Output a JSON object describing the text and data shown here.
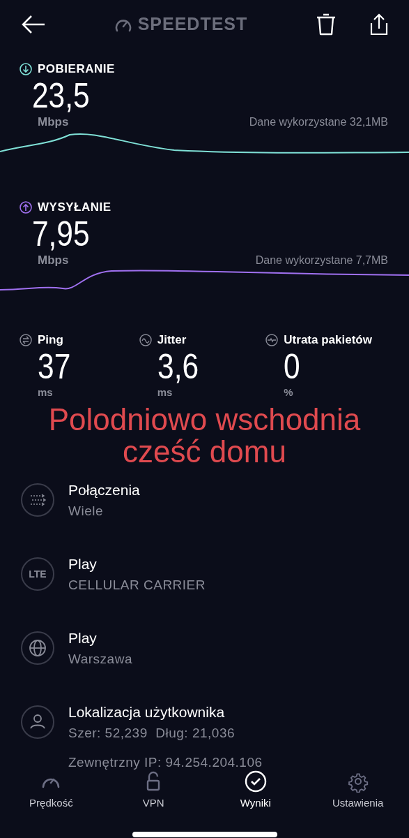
{
  "header": {
    "title": "SPEEDTEST"
  },
  "download": {
    "label": "POBIERANIE",
    "value": "23,5",
    "unit": "Mbps",
    "data_used": "Dane wykorzystane 32,1MB"
  },
  "upload": {
    "label": "WYSYŁANIE",
    "value": "7,95",
    "unit": "Mbps",
    "data_used": "Dane wykorzystane 7,7MB"
  },
  "metrics": [
    {
      "kind": "ping",
      "label": "Ping",
      "value": "37",
      "unit": "ms"
    },
    {
      "kind": "jitter",
      "label": "Jitter",
      "value": "3,6",
      "unit": "ms"
    },
    {
      "kind": "loss",
      "label": "Utrata pakietów",
      "value": "0",
      "unit": "%"
    }
  ],
  "annotation": [
    "Polodniowo wschodnia",
    "cześć domu"
  ],
  "info": [
    {
      "kind": "connections",
      "title": "Połączenia",
      "lines": [
        "Wiele"
      ]
    },
    {
      "kind": "lte",
      "badge": "LTE",
      "title": "Play",
      "lines": [
        "CELLULAR CARRIER"
      ]
    },
    {
      "kind": "globe",
      "title": "Play",
      "lines": [
        "Warszawa"
      ]
    },
    {
      "kind": "user",
      "title": "Lokalizacja użytkownika",
      "lines": [
        "Szer: 52,239  Dług: 21,036",
        "Zewnętrzny IP: 94.254.204.106"
      ]
    }
  ],
  "tabs": [
    {
      "kind": "speed",
      "label": "Prędkość",
      "selected": false
    },
    {
      "kind": "vpn",
      "label": "VPN",
      "selected": false
    },
    {
      "kind": "results",
      "label": "Wyniki",
      "selected": true
    },
    {
      "kind": "settings",
      "label": "Ustawienia",
      "selected": false
    }
  ]
}
